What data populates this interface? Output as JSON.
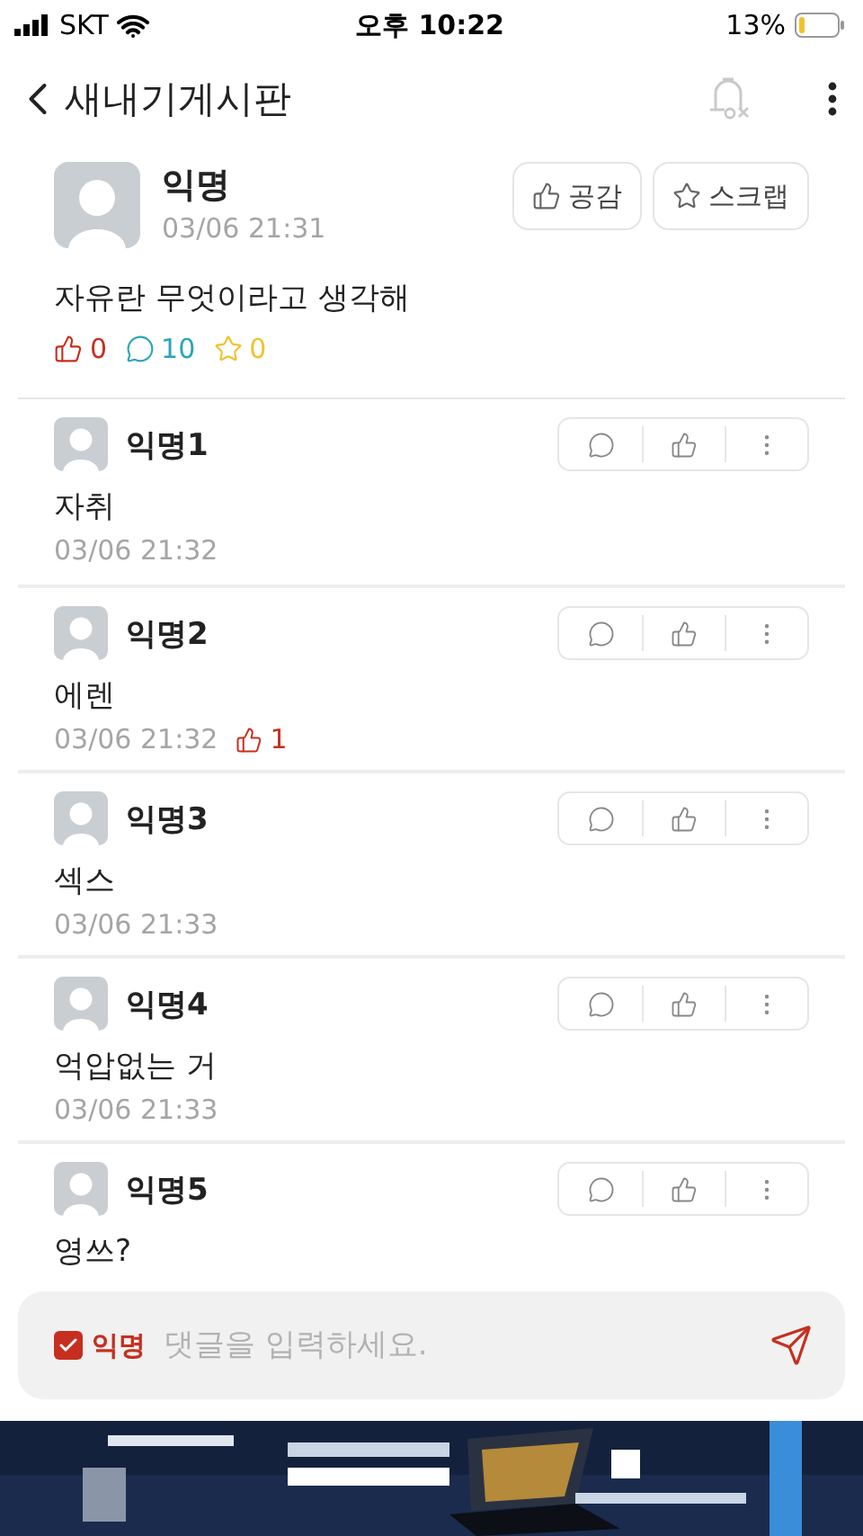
{
  "status_bar": {
    "carrier": "SKT",
    "time": "오후 10:22",
    "battery": "13%"
  },
  "header": {
    "title": "새내기게시판"
  },
  "post": {
    "author": "익명",
    "time": "03/06 21:31",
    "buttons": [
      {
        "kind": "like",
        "label": "공감"
      },
      {
        "kind": "scrap",
        "label": "스크랩"
      }
    ],
    "body": "자유란 무엇이라고 생각해",
    "stats": [
      {
        "kind": "like",
        "value": "0",
        "color": "#c62f1f"
      },
      {
        "kind": "comment",
        "value": "10",
        "color": "#2aa5b8"
      },
      {
        "kind": "scrap",
        "value": "0",
        "color": "#f2c12e"
      }
    ]
  },
  "comments": [
    {
      "author": "익명1",
      "body": "자취",
      "time": "03/06 21:32"
    },
    {
      "author": "익명2",
      "body": "에렌",
      "time": "03/06 21:32",
      "likes": "1"
    },
    {
      "author": "익명3",
      "body": "섹스",
      "time": "03/06 21:33"
    },
    {
      "author": "익명4",
      "body": "억압없는 거",
      "time": "03/06 21:33"
    },
    {
      "author": "익명5",
      "body": "영쓰?"
    }
  ],
  "composer": {
    "anonymous": {
      "label": "익명",
      "checked": true
    },
    "placeholder": "댓글을 입력하세요."
  }
}
